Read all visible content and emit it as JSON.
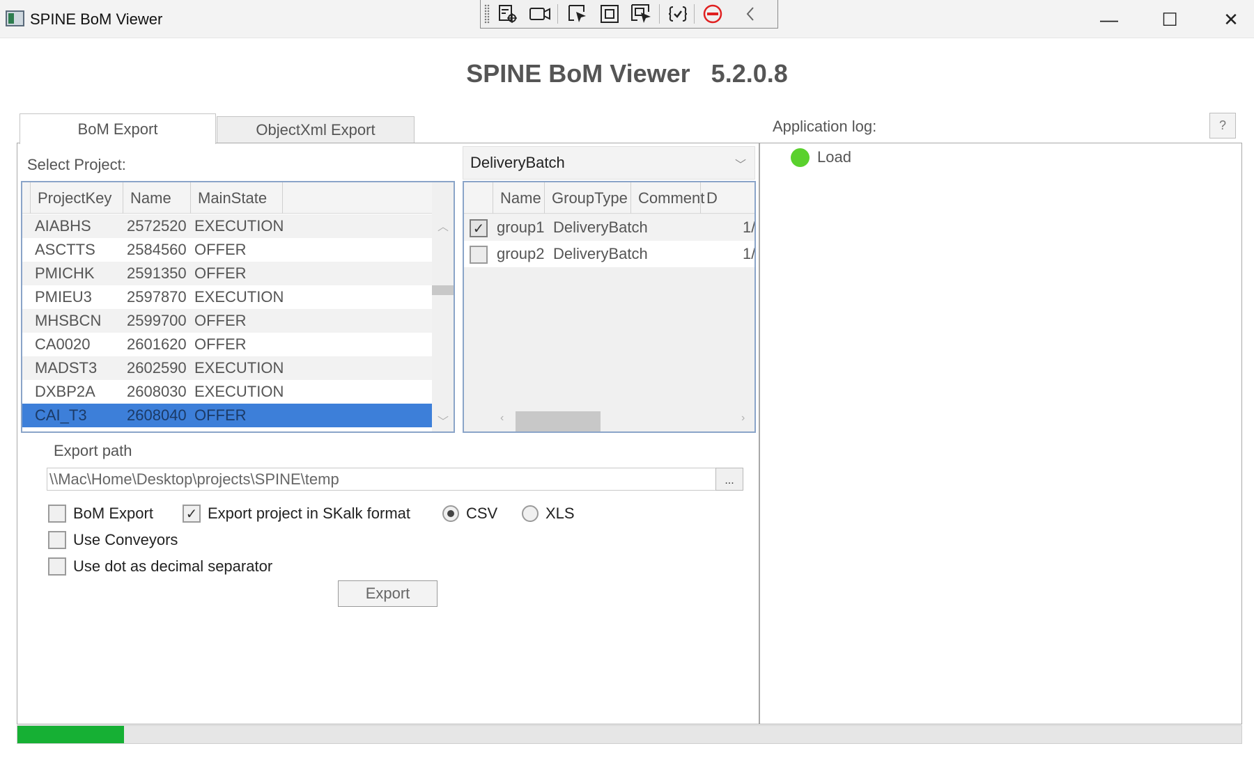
{
  "window": {
    "title": "SPINE BoM Viewer",
    "minimize_glyph": "—",
    "maximize_glyph": "☐",
    "close_glyph": "✕"
  },
  "header": {
    "title": "SPINE BoM Viewer   5.2.0.8"
  },
  "tabs": [
    {
      "label": "BoM Export",
      "selected": true
    },
    {
      "label": "ObjectXml Export",
      "selected": false
    }
  ],
  "projects": {
    "label": "Select Project:",
    "columns": [
      "ProjectKey",
      "Name",
      "MainState"
    ],
    "rows": [
      {
        "key": "AIABHS",
        "name": "2572520",
        "state": "EXECUTION"
      },
      {
        "key": "ASCTTS",
        "name": "2584560",
        "state": "OFFER"
      },
      {
        "key": "PMICHK",
        "name": "2591350",
        "state": "OFFER"
      },
      {
        "key": "PMIEU3",
        "name": "2597870",
        "state": "EXECUTION"
      },
      {
        "key": "MHSBCN",
        "name": "2599700",
        "state": "OFFER"
      },
      {
        "key": "CA0020",
        "name": "2601620",
        "state": "OFFER"
      },
      {
        "key": "MADST3",
        "name": "2602590",
        "state": "EXECUTION"
      },
      {
        "key": "DXBP2A",
        "name": "2608030",
        "state": "EXECUTION"
      },
      {
        "key": "CAI_T3",
        "name": "2608040",
        "state": "OFFER"
      }
    ],
    "selected_index": 8
  },
  "group_filter": {
    "value": "DeliveryBatch"
  },
  "groups": {
    "columns": [
      "Name",
      "GroupType",
      "Comment",
      "D"
    ],
    "rows": [
      {
        "checked": true,
        "name": "group1",
        "type": "DeliveryBatch",
        "date": "1/"
      },
      {
        "checked": false,
        "name": "group2",
        "type": "DeliveryBatch",
        "date": "1/"
      }
    ]
  },
  "export": {
    "path_label": "Export path",
    "path_value": "\\\\Mac\\Home\\Desktop\\projects\\SPINE\\temp",
    "browse_label": "...",
    "options": {
      "bom_export": {
        "label": "BoM Export",
        "checked": false
      },
      "skalk": {
        "label": "Export project in SKalk format",
        "checked": true
      },
      "csv": {
        "label": "CSV",
        "selected": true
      },
      "xls": {
        "label": "XLS",
        "selected": false
      },
      "conveyors": {
        "label": "Use Conveyors",
        "checked": false
      },
      "dot_separator": {
        "label": "Use dot as decimal separator",
        "checked": false
      }
    },
    "button_label": "Export"
  },
  "log": {
    "title": "Application log:",
    "help_label": "?",
    "entries": [
      {
        "status": "ok",
        "text": "Load"
      }
    ]
  },
  "progress": {
    "fraction": 0.087
  },
  "colors": {
    "accent": "#3d7fd9",
    "progress": "#16b034",
    "status_ok": "#5ad12d"
  }
}
